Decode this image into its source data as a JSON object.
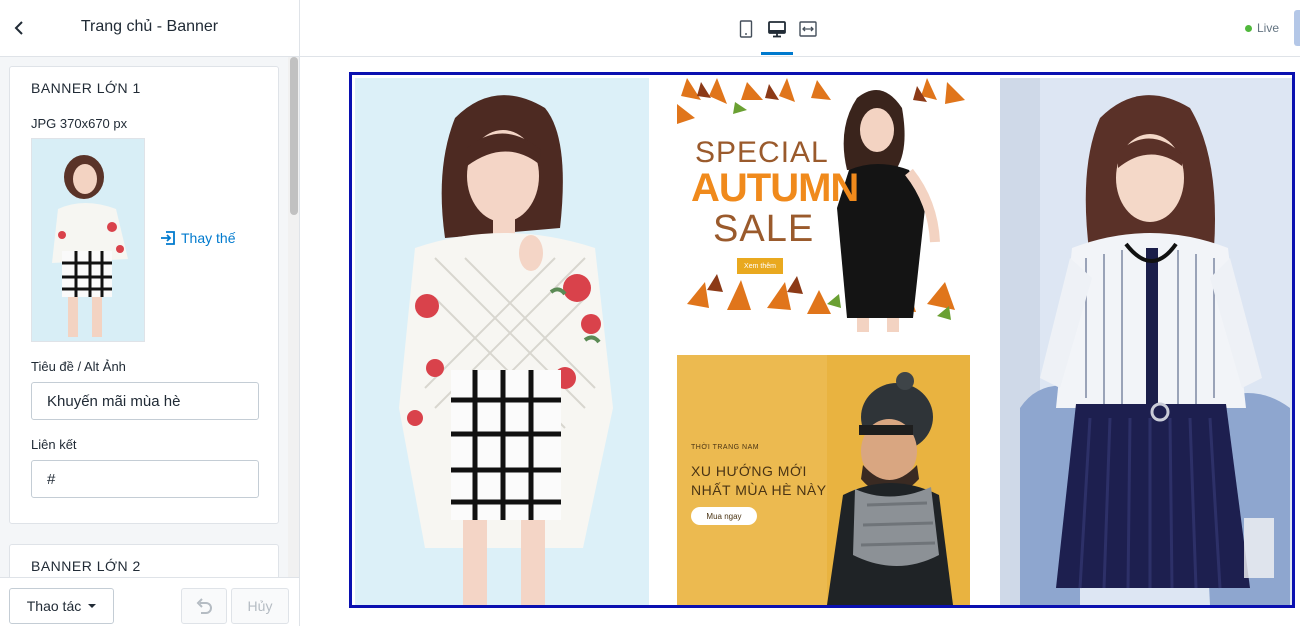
{
  "sidebar": {
    "title": "Trang chủ - Banner",
    "section1": {
      "title": "BANNER LỚN 1",
      "image_note": "JPG 370x670 px",
      "replace_label": "Thay thế",
      "title_label": "Tiêu đề / Alt Ảnh",
      "title_value": "Khuyến mãi mùa hè",
      "link_label": "Liên kết",
      "link_value": "#"
    },
    "section2": {
      "title": "BANNER LỚN 2"
    },
    "footer": {
      "actions_label": "Thao tác",
      "cancel_label": "Hủy"
    }
  },
  "topbar": {
    "devices": [
      "mobile-icon",
      "desktop-icon",
      "fullwidth-icon"
    ],
    "active_device": "desktop",
    "live_label": "Live"
  },
  "preview": {
    "autumn": {
      "line1": "SPECIAL",
      "line2": "AUTUMN",
      "line3": "SALE",
      "cta": "Xem thêm"
    },
    "men": {
      "kicker": "THỜI TRANG NAM",
      "title": "XU HƯỚNG MỚI NHẤT MÙA HÈ NÀY",
      "cta": "Mua ngay"
    }
  },
  "colors": {
    "accent": "#007ace",
    "frame": "#0a10b0",
    "live": "#50b83c"
  }
}
